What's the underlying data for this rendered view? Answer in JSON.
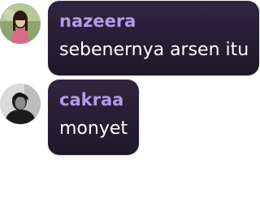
{
  "messages": [
    {
      "username": "nazeera",
      "text": "sebenernya arsen itu",
      "username_color": "#b39be6",
      "avatar": "user-photo-avatar"
    },
    {
      "username": "cakraa",
      "text": "monyet",
      "username_color": "#b39be6",
      "avatar": "user-photo-avatar"
    }
  ],
  "bubble_color": "#261e33"
}
